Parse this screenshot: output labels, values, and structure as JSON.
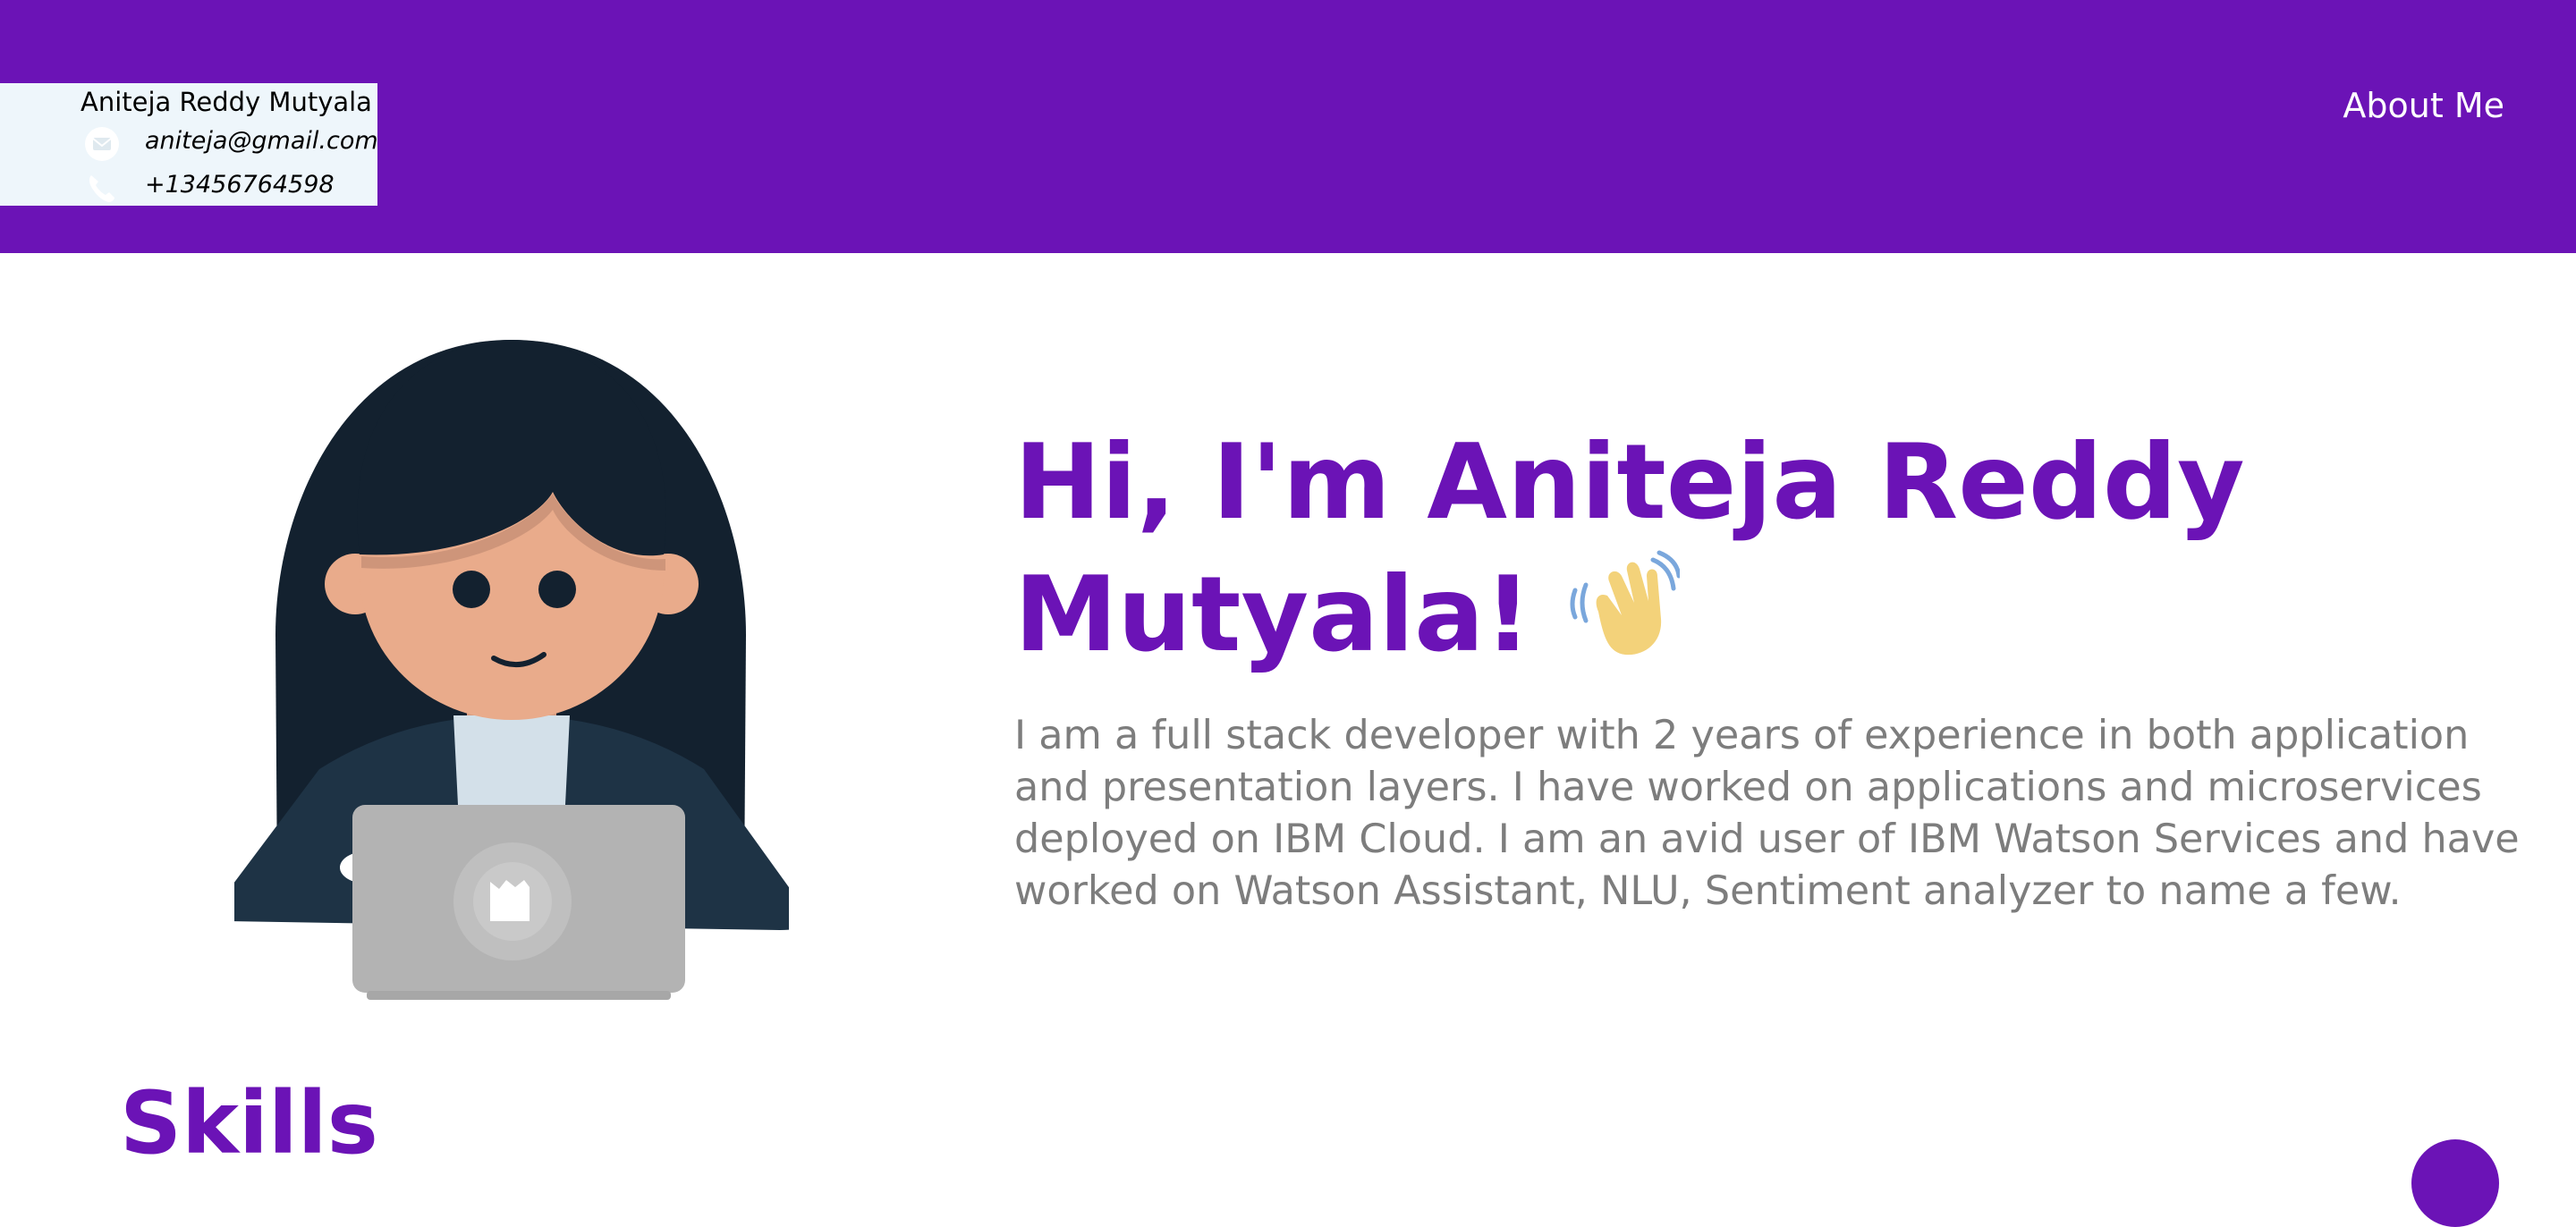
{
  "header": {
    "contact_card": {
      "name": "Aniteja Reddy Mutyala",
      "email": "aniteja@gmail.com",
      "phone": "+13456764598",
      "email_icon": "mail-icon",
      "phone_icon": "phone-icon"
    },
    "nav": {
      "about_label": "About Me"
    }
  },
  "hero": {
    "title": "Hi, I'm Aniteja Reddy Mutyala!",
    "emoji_icon": "waving-hand-icon",
    "illustration_icon": "developer-with-laptop-illustration",
    "description": "I am a full stack developer with 2 years of experience in both application and presentation layers. I have worked on applications and microservices deployed on IBM Cloud. I am an avid user of IBM Watson Services and have worked on Watson Assistant, NLU, Sentiment analyzer to name a few."
  },
  "skills": {
    "heading": "Skills"
  },
  "colors": {
    "brand": "#6b13b6",
    "header_bg": "#6b13b6",
    "contact_card_bg": "#eef6fb",
    "description_text": "#7d7d7d"
  }
}
